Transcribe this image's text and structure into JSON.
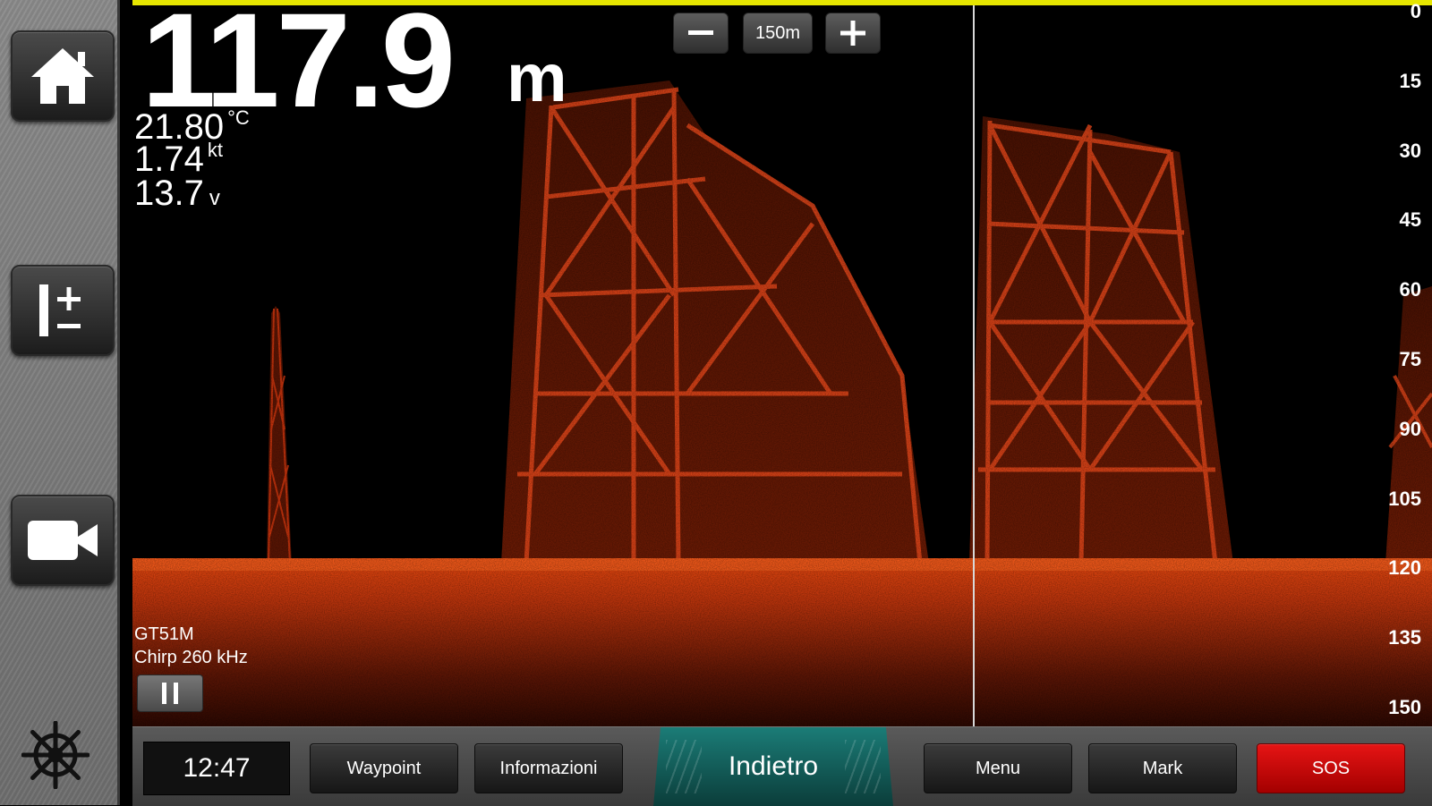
{
  "readouts": {
    "depth_value": "117.9",
    "depth_unit": "m",
    "temperature": "21.80",
    "temperature_unit": "°C",
    "speed": "1.74",
    "speed_unit": "kt",
    "voltage": "13.7",
    "voltage_unit": "v"
  },
  "range": {
    "value": "150m",
    "minus": "−",
    "plus": "+"
  },
  "depth_scale": [
    "0",
    "15",
    "30",
    "45",
    "60",
    "75",
    "90",
    "105",
    "120",
    "135",
    "150"
  ],
  "transducer": {
    "model": "GT51M",
    "frequency": "Chirp 260 kHz"
  },
  "bottom_bar": {
    "time": "12:47",
    "waypoint": "Waypoint",
    "info": "Informazioni",
    "back": "Indietro",
    "menu": "Menu",
    "mark": "Mark",
    "sos": "SOS"
  },
  "colors": {
    "sonar_return": "#d8380f",
    "range_line": "#e6e600",
    "sos": "#e61414",
    "back_button": "#1b7c77"
  },
  "icons": {
    "home": "home-icon",
    "zoom": "range-adjust-icon",
    "video": "video-camera-icon",
    "helm": "ship-wheel-icon"
  }
}
